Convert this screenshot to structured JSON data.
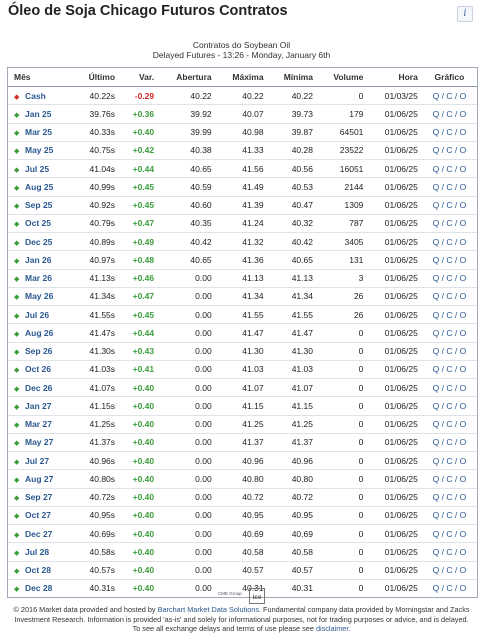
{
  "header": {
    "title": "Óleo de Soja Chicago Futuros Contratos",
    "info_icon": "i",
    "sub_line1": "Contratos do Soybean Oil",
    "sub_line2": "Delayed Futures - 13:26 - Monday, January 6th"
  },
  "table": {
    "columns": [
      "Mês",
      "Último",
      "Var.",
      "Abertura",
      "Máxima",
      "Mínima",
      "Volume",
      "Hora",
      "Gráfico"
    ],
    "rows": [
      {
        "month": "Cash",
        "last": "40.22s",
        "change": "-0.29",
        "open": "40.22",
        "high": "40.22",
        "low": "40.22",
        "volume": "0",
        "time": "01/03/25",
        "dir": "down"
      },
      {
        "month": "Jan 25",
        "last": "39.76s",
        "change": "+0.36",
        "open": "39.92",
        "high": "40.07",
        "low": "39.73",
        "volume": "179",
        "time": "01/06/25",
        "dir": "up"
      },
      {
        "month": "Mar 25",
        "last": "40.33s",
        "change": "+0.40",
        "open": "39.99",
        "high": "40.98",
        "low": "39.87",
        "volume": "64501",
        "time": "01/06/25",
        "dir": "up"
      },
      {
        "month": "May 25",
        "last": "40.75s",
        "change": "+0.42",
        "open": "40.38",
        "high": "41.33",
        "low": "40.28",
        "volume": "23522",
        "time": "01/06/25",
        "dir": "up"
      },
      {
        "month": "Jul 25",
        "last": "41.04s",
        "change": "+0.44",
        "open": "40.65",
        "high": "41.56",
        "low": "40.56",
        "volume": "16051",
        "time": "01/06/25",
        "dir": "up"
      },
      {
        "month": "Aug 25",
        "last": "40.99s",
        "change": "+0.45",
        "open": "40.59",
        "high": "41.49",
        "low": "40.53",
        "volume": "2144",
        "time": "01/06/25",
        "dir": "up"
      },
      {
        "month": "Sep 25",
        "last": "40.92s",
        "change": "+0.45",
        "open": "40.60",
        "high": "41.39",
        "low": "40.47",
        "volume": "1309",
        "time": "01/06/25",
        "dir": "up"
      },
      {
        "month": "Oct 25",
        "last": "40.79s",
        "change": "+0.47",
        "open": "40.35",
        "high": "41.24",
        "low": "40.32",
        "volume": "787",
        "time": "01/06/25",
        "dir": "up"
      },
      {
        "month": "Dec 25",
        "last": "40.89s",
        "change": "+0.49",
        "open": "40.42",
        "high": "41.32",
        "low": "40.42",
        "volume": "3405",
        "time": "01/06/25",
        "dir": "up"
      },
      {
        "month": "Jan 26",
        "last": "40.97s",
        "change": "+0.48",
        "open": "40.65",
        "high": "41.36",
        "low": "40.65",
        "volume": "131",
        "time": "01/06/25",
        "dir": "up"
      },
      {
        "month": "Mar 26",
        "last": "41.13s",
        "change": "+0.46",
        "open": "0.00",
        "high": "41.13",
        "low": "41.13",
        "volume": "3",
        "time": "01/06/25",
        "dir": "up"
      },
      {
        "month": "May 26",
        "last": "41.34s",
        "change": "+0.47",
        "open": "0.00",
        "high": "41.34",
        "low": "41.34",
        "volume": "26",
        "time": "01/06/25",
        "dir": "up"
      },
      {
        "month": "Jul 26",
        "last": "41.55s",
        "change": "+0.45",
        "open": "0.00",
        "high": "41.55",
        "low": "41.55",
        "volume": "26",
        "time": "01/06/25",
        "dir": "up"
      },
      {
        "month": "Aug 26",
        "last": "41.47s",
        "change": "+0.44",
        "open": "0.00",
        "high": "41.47",
        "low": "41.47",
        "volume": "0",
        "time": "01/06/25",
        "dir": "up"
      },
      {
        "month": "Sep 26",
        "last": "41.30s",
        "change": "+0.43",
        "open": "0.00",
        "high": "41.30",
        "low": "41.30",
        "volume": "0",
        "time": "01/06/25",
        "dir": "up"
      },
      {
        "month": "Oct 26",
        "last": "41.03s",
        "change": "+0.41",
        "open": "0.00",
        "high": "41.03",
        "low": "41.03",
        "volume": "0",
        "time": "01/06/25",
        "dir": "up"
      },
      {
        "month": "Dec 26",
        "last": "41.07s",
        "change": "+0.40",
        "open": "0.00",
        "high": "41.07",
        "low": "41.07",
        "volume": "0",
        "time": "01/06/25",
        "dir": "up"
      },
      {
        "month": "Jan 27",
        "last": "41.15s",
        "change": "+0.40",
        "open": "0.00",
        "high": "41.15",
        "low": "41.15",
        "volume": "0",
        "time": "01/06/25",
        "dir": "up"
      },
      {
        "month": "Mar 27",
        "last": "41.25s",
        "change": "+0.40",
        "open": "0.00",
        "high": "41.25",
        "low": "41.25",
        "volume": "0",
        "time": "01/06/25",
        "dir": "up"
      },
      {
        "month": "May 27",
        "last": "41.37s",
        "change": "+0.40",
        "open": "0.00",
        "high": "41.37",
        "low": "41.37",
        "volume": "0",
        "time": "01/06/25",
        "dir": "up"
      },
      {
        "month": "Jul 27",
        "last": "40.96s",
        "change": "+0.40",
        "open": "0.00",
        "high": "40.96",
        "low": "40.96",
        "volume": "0",
        "time": "01/06/25",
        "dir": "up"
      },
      {
        "month": "Aug 27",
        "last": "40.80s",
        "change": "+0.40",
        "open": "0.00",
        "high": "40.80",
        "low": "40.80",
        "volume": "0",
        "time": "01/06/25",
        "dir": "up"
      },
      {
        "month": "Sep 27",
        "last": "40.72s",
        "change": "+0.40",
        "open": "0.00",
        "high": "40.72",
        "low": "40.72",
        "volume": "0",
        "time": "01/06/25",
        "dir": "up"
      },
      {
        "month": "Oct 27",
        "last": "40.95s",
        "change": "+0.40",
        "open": "0.00",
        "high": "40.95",
        "low": "40.95",
        "volume": "0",
        "time": "01/06/25",
        "dir": "up"
      },
      {
        "month": "Dec 27",
        "last": "40.69s",
        "change": "+0.40",
        "open": "0.00",
        "high": "40.69",
        "low": "40.69",
        "volume": "0",
        "time": "01/06/25",
        "dir": "up"
      },
      {
        "month": "Jul 28",
        "last": "40.58s",
        "change": "+0.40",
        "open": "0.00",
        "high": "40.58",
        "low": "40.58",
        "volume": "0",
        "time": "01/06/25",
        "dir": "up"
      },
      {
        "month": "Oct 28",
        "last": "40.57s",
        "change": "+0.40",
        "open": "0.00",
        "high": "40.57",
        "low": "40.57",
        "volume": "0",
        "time": "01/06/25",
        "dir": "up"
      },
      {
        "month": "Dec 28",
        "last": "40.31s",
        "change": "+0.40",
        "open": "0.00",
        "high": "40.31",
        "low": "40.31",
        "volume": "0",
        "time": "01/06/25",
        "dir": "up"
      }
    ],
    "chart_links": [
      "Q",
      "C",
      "O"
    ],
    "chart_link_sep": " / "
  },
  "logos": {
    "cme": "CME Group",
    "ice": "ice"
  },
  "footer": {
    "text_before_link1": "© 2016 Market data provided and hosted by ",
    "link1": "Barchart Market Data Solutions",
    "text_middle": ". Fundamental company data provided by Morningstar and Zacks Investment Research. Information is provided 'as-is' and solely for informational purposes, not for trading purposes or advice, and is delayed. To see all exchange delays and terms of use please see ",
    "link2": "disclaimer",
    "text_end": "."
  },
  "colors": {
    "up": "#3a9d3a",
    "down": "#d22b2b",
    "link": "#2b5891"
  }
}
